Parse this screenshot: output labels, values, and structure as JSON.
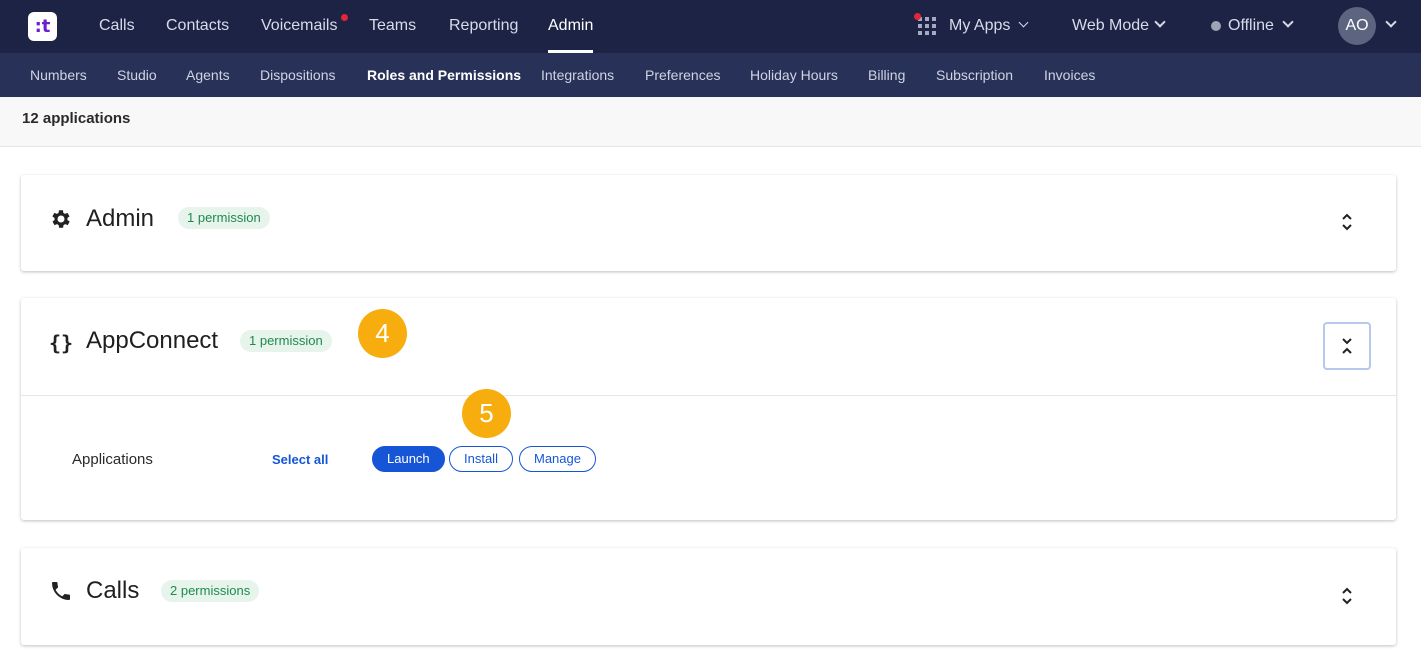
{
  "topnav": {
    "items": [
      "Calls",
      "Contacts",
      "Voicemails",
      "Teams",
      "Reporting",
      "Admin"
    ],
    "active": "Admin",
    "my_apps": "My Apps",
    "web_mode": "Web Mode",
    "status": "Offline",
    "avatar_initials": "AO"
  },
  "subnav": {
    "items": [
      "Numbers",
      "Studio",
      "Agents",
      "Dispositions",
      "Roles and Permissions",
      "Integrations",
      "Preferences",
      "Holiday Hours",
      "Billing",
      "Subscription",
      "Invoices"
    ],
    "active": "Roles and Permissions"
  },
  "summary": {
    "count_label": "12 applications"
  },
  "cards": [
    {
      "title": "Admin",
      "badge": "1 permission",
      "icon": "gear-icon",
      "expanded": false
    },
    {
      "title": "AppConnect",
      "badge": "1 permission",
      "icon": "braces-icon",
      "expanded": true,
      "permission": {
        "label": "Applications",
        "select_all": "Select all",
        "options": [
          {
            "label": "Launch",
            "selected": true
          },
          {
            "label": "Install",
            "selected": false
          },
          {
            "label": "Manage",
            "selected": false
          }
        ]
      }
    },
    {
      "title": "Calls",
      "badge": "2 permissions",
      "icon": "phone-icon",
      "expanded": false
    }
  ],
  "markers": [
    "4",
    "5"
  ],
  "colors": {
    "topbar": "#1c2345",
    "subbar": "#283258",
    "accent": "#1656d6",
    "badge_bg": "#e6f4ec",
    "badge_text": "#1f8a4c",
    "marker": "#f7ad0e",
    "notification": "#e3243b"
  }
}
